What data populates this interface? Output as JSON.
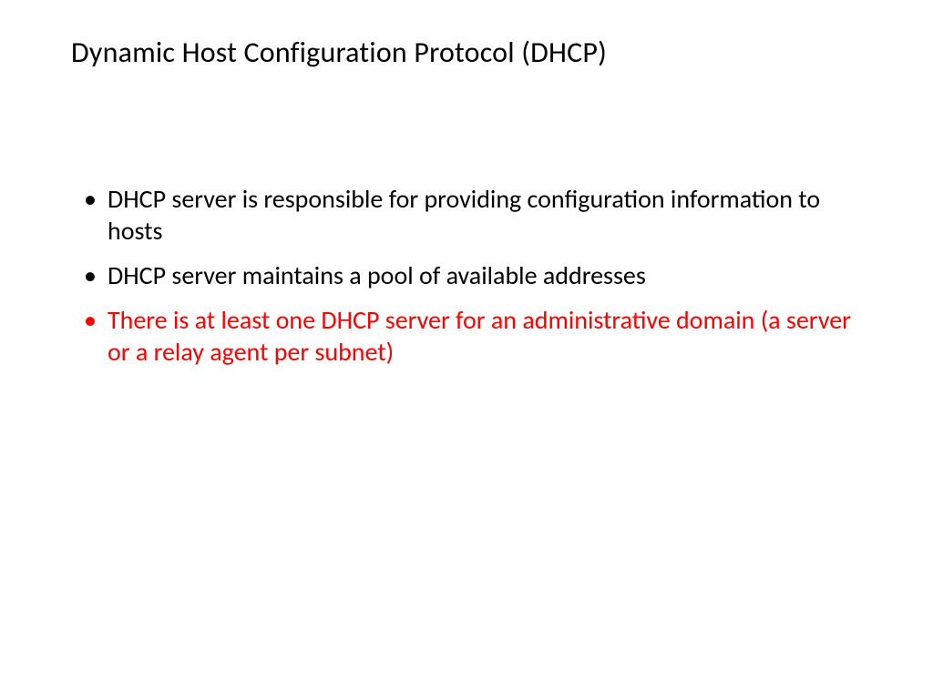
{
  "slide": {
    "title": "Dynamic Host Configuration Protocol (DHCP)",
    "bullets": [
      {
        "text": "DHCP server is responsible for providing configuration information to hosts",
        "highlight": false
      },
      {
        "text": "DHCP server maintains a pool of available addresses",
        "highlight": false
      },
      {
        "text": "There is at least one DHCP server for an administrative domain (a server or a relay agent per subnet)",
        "highlight": true
      }
    ]
  },
  "colors": {
    "highlight": "#ff0000",
    "text": "#000000",
    "background": "#ffffff"
  }
}
